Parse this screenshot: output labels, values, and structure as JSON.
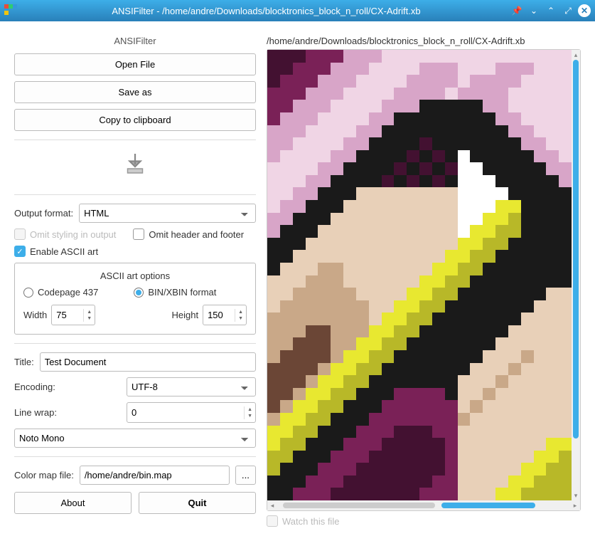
{
  "titlebar": {
    "title": "ANSIFilter - /home/andre/Downloads/blocktronics_block_n_roll/CX-Adrift.xb"
  },
  "panel": {
    "app_title": "ANSIFilter",
    "open_file": "Open File",
    "save_as": "Save as",
    "copy_clipboard": "Copy to clipboard",
    "output_format_label": "Output format:",
    "output_format_value": "HTML",
    "omit_styling": "Omit styling in output",
    "omit_header": "Omit header and footer",
    "enable_ascii": "Enable ASCII art",
    "ascii_group_title": "ASCII art options",
    "codepage_437": "Codepage 437",
    "bin_xbin": "BIN/XBIN format",
    "width_label": "Width",
    "width_value": "75",
    "height_label": "Height",
    "height_value": "150",
    "title_label": "Title:",
    "title_value": "Test Document",
    "encoding_label": "Encoding:",
    "encoding_value": "UTF-8",
    "linewrap_label": "Line wrap:",
    "linewrap_value": "0",
    "font_value": "Noto Mono",
    "colormap_label": "Color map file:",
    "colormap_value": "/home/andre/bin.map",
    "browse": "...",
    "about": "About",
    "quit": "Quit"
  },
  "preview": {
    "path": "/home/andre/Downloads/blocktronics_block_n_roll/CX-Adrift.xb",
    "watch": "Watch this file"
  }
}
